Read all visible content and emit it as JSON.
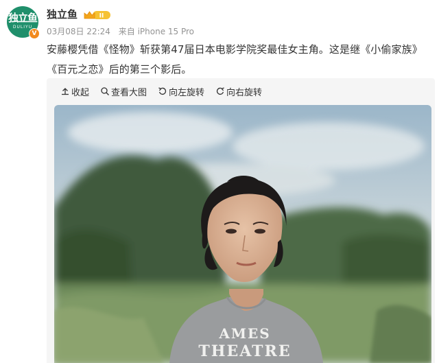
{
  "post": {
    "author": "独立鱼",
    "avatar_text": "独立鱼",
    "avatar_subtext": "DULIYU",
    "verified_mark": "V",
    "vip_level": "II",
    "date": "03月08日 22:24",
    "source": "来自 iPhone 15 Pro",
    "text": "安藤樱凭借《怪物》斩获第47届日本电影学院奖最佳女主角。这是继《小偷家族》《百元之恋》后的第三个影后。"
  },
  "toolbar": {
    "collapse": "收起",
    "view_large": "查看大图",
    "rotate_left": "向左旋转",
    "rotate_right": "向右旋转"
  },
  "photo": {
    "shirt_text": [
      "AMES",
      "THEATRE"
    ]
  },
  "colors": {
    "avatar_bg": "#1f8f6b",
    "verified": "#f28a1e",
    "meta_text": "#939393",
    "media_bg": "#f5f5f5"
  }
}
